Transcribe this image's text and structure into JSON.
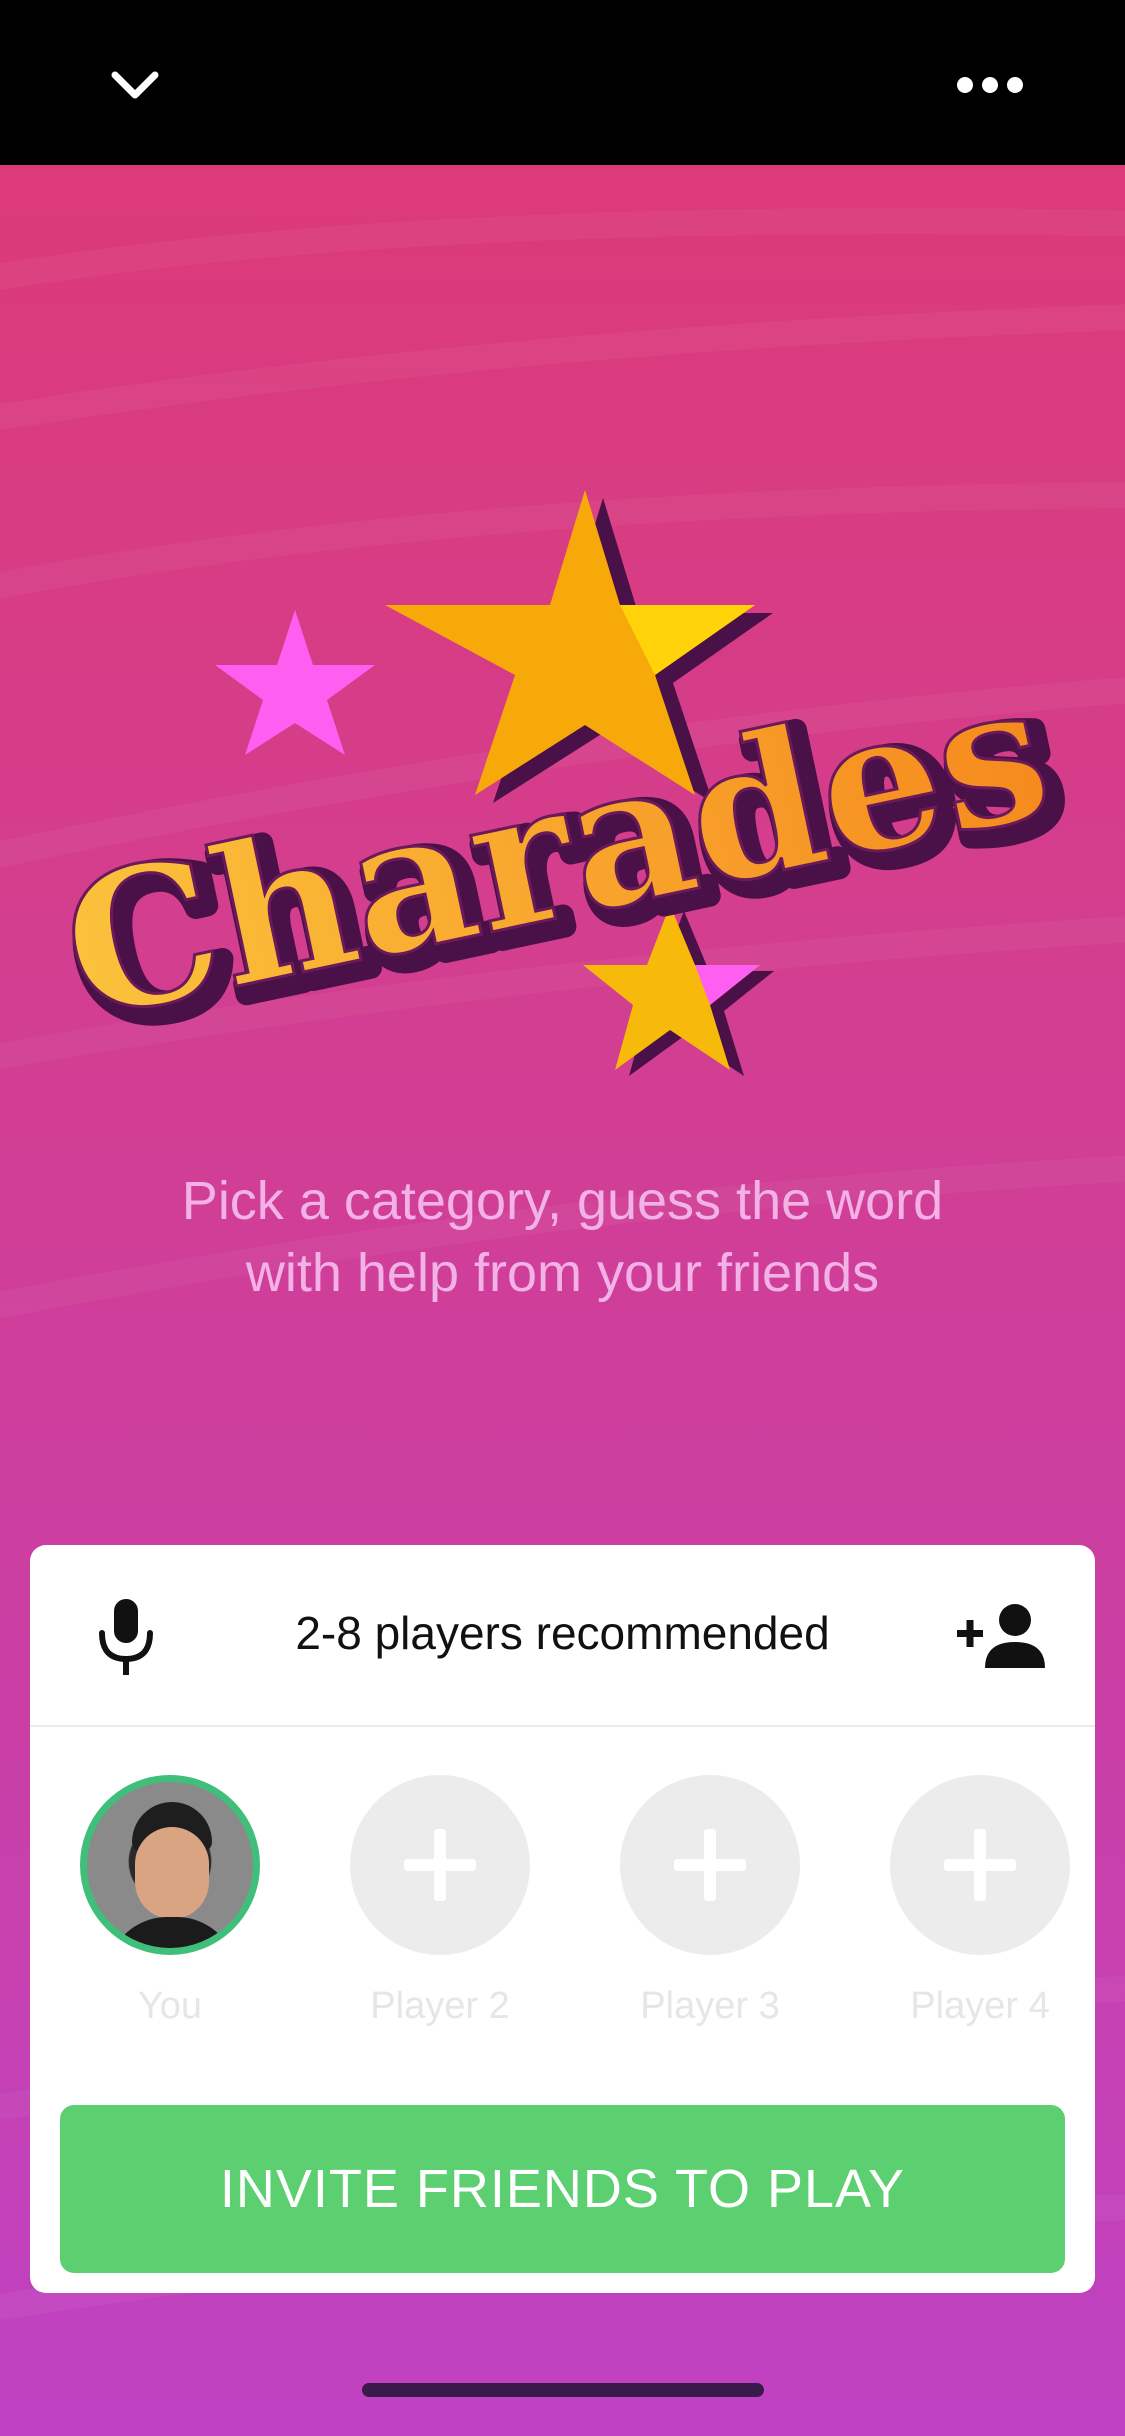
{
  "topbar": {
    "collapse_icon": "chevron-down-icon",
    "more_icon": "more-dots-icon"
  },
  "game": {
    "logo_text": "Charades",
    "tagline": "Pick a category, guess the word\nwith help from your friends"
  },
  "card": {
    "mic_icon": "microphone-icon",
    "players_recommended": "2-8 players recommended",
    "add_person_icon": "add-person-icon",
    "slots": [
      {
        "label": "You",
        "type": "avatar"
      },
      {
        "label": "Player 2",
        "type": "empty"
      },
      {
        "label": "Player 3",
        "type": "empty"
      },
      {
        "label": "Player 4",
        "type": "empty"
      }
    ],
    "invite_label": "INVITE FRIENDS TO PLAY"
  },
  "colors": {
    "bg_top": "#dc3a78",
    "bg_bottom": "#bf42c3",
    "tagline": "#f2b2e6",
    "invite_button": "#5ccf70",
    "avatar_ring": "#3fbf7a"
  }
}
